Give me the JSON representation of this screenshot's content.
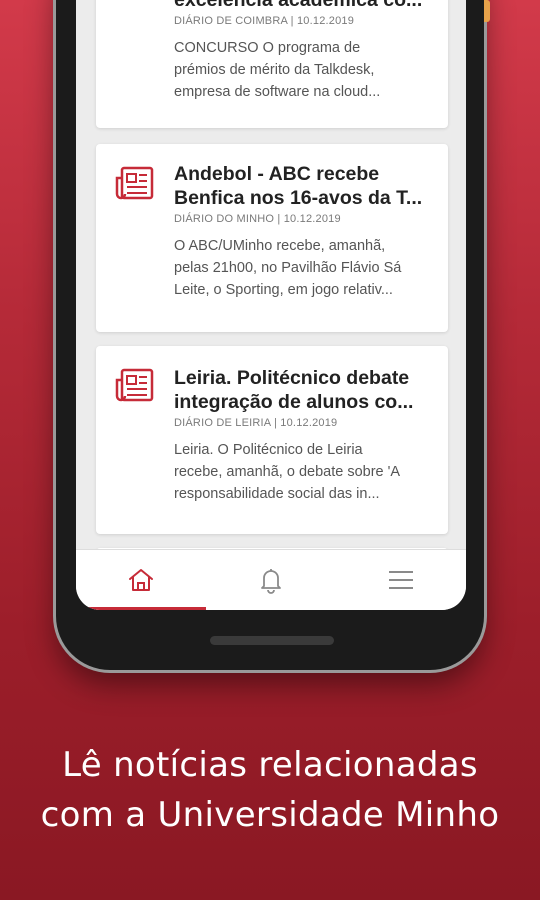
{
  "cards": [
    {
      "title_lines": [
        "excelência académica co..."
      ],
      "source": "DIÁRIO DE COIMBRA | 10.12.2019",
      "snippet_lines": [
        "CONCURSO O programa de",
        "prémios de mérito da Talkdesk,",
        "empresa de software na cloud..."
      ]
    },
    {
      "title_lines": [
        "Andebol - ABC recebe",
        "Benfica nos 16-avos da T..."
      ],
      "source": "DIÁRIO DO MINHO | 10.12.2019",
      "snippet_lines": [
        "O ABC/UMinho recebe, amanhã,",
        "pelas 21h00, no Pavilhão Flávio Sá",
        "Leite, o Sporting, em jogo relativ..."
      ]
    },
    {
      "title_lines": [
        "Leiria. Politécnico debate",
        "integração de alunos co..."
      ],
      "source": "DIÁRIO DE LEIRIA | 10.12.2019",
      "snippet_lines": [
        "Leiria. O Politécnico de Leiria",
        "recebe, amanhã, o debate sobre 'A",
        "responsabilidade social das in..."
      ]
    }
  ],
  "tabs": [
    {
      "icon": "home-icon",
      "active": true
    },
    {
      "icon": "bell-icon",
      "active": false
    },
    {
      "icon": "menu-icon",
      "active": false
    }
  ],
  "tagline": [
    "Lê notícias relacionadas",
    "com a Universidade Minho"
  ],
  "colors": {
    "accent": "#c62b38",
    "background": "#b52a38",
    "text_dark": "#222222"
  }
}
